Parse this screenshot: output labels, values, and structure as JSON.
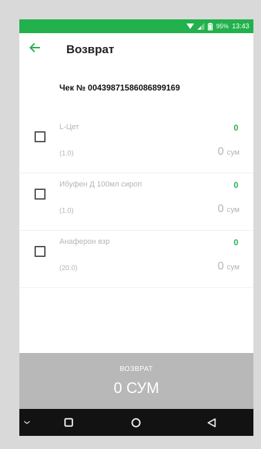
{
  "status_bar": {
    "battery": "95%",
    "time": "13:43",
    "bg_color": "#22b14c",
    "icons": [
      "wifi-icon",
      "signal-icon",
      "battery-icon"
    ]
  },
  "app_bar": {
    "back_icon": "arrow-left-icon",
    "title": "Возврат"
  },
  "receipt": {
    "label": "Чек № 00439871586086899169"
  },
  "items": [
    {
      "name": "L-Цет",
      "qty": "(1.0)",
      "count": "0",
      "sum": "0",
      "currency": "сум",
      "checked": false
    },
    {
      "name": "Ибуфен Д 100мл сироп",
      "qty": "(1.0)",
      "count": "0",
      "sum": "0",
      "currency": "сум",
      "checked": false
    },
    {
      "name": "Анаферон взр",
      "qty": "(20.0)",
      "count": "0",
      "sum": "0",
      "currency": "сум",
      "checked": false
    }
  ],
  "footer": {
    "label": "ВОЗВРАТ",
    "total": "0 СУМ",
    "bg_color": "#b8b8b8"
  },
  "nav_bar": {
    "icons": [
      "chevron-down-icon",
      "recents-icon",
      "home-icon",
      "back-triangle-icon"
    ]
  }
}
